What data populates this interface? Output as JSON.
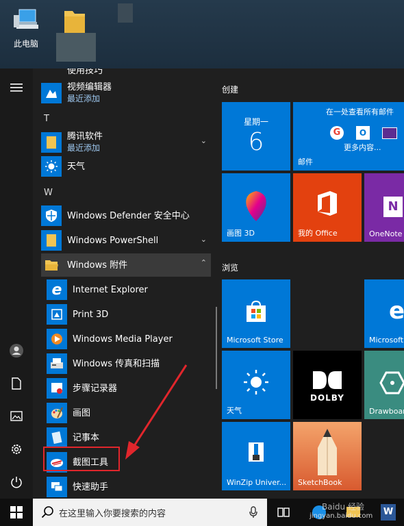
{
  "desktop": {
    "this_pc_label": "此电脑"
  },
  "applist": {
    "partial_top": "使用技巧",
    "video_editor": {
      "name": "视频编辑器",
      "sub": "最近添加"
    },
    "letter_t": "T",
    "tencent": {
      "name": "腾讯软件",
      "sub": "最近添加"
    },
    "weather": "天气",
    "letter_w": "W",
    "defender": "Windows Defender 安全中心",
    "powershell": "Windows PowerShell",
    "accessories": "Windows 附件",
    "ie": "Internet Explorer",
    "print3d": "Print 3D",
    "wmp": "Windows Media Player",
    "fax": "Windows 传真和扫描",
    "steps": "步骤记录器",
    "paint": "画图",
    "notepad": "记事本",
    "snipping": "截图工具",
    "quickassist": "快速助手"
  },
  "tiles": {
    "group_create": "创建",
    "calendar_day": "星期一",
    "calendar_date": "6",
    "mail_header": "在一处查看所有邮件",
    "mail_more": "更多内容...",
    "mail_label": "邮件",
    "paint3d": "画图 3D",
    "office": "我的 Office",
    "onenote": "OneNote",
    "group_browse": "浏览",
    "store": "Microsoft Store",
    "edge": "Microsoft",
    "weather": "天气",
    "drawboard": "Drawboar",
    "winzip": "WinZip Univer...",
    "sketchbook": "SketchBook"
  },
  "taskbar": {
    "search_placeholder": "在这里输入你要搜索的内容"
  },
  "watermark": {
    "site": "jingyan.baidu.com",
    "brand": "Baidu 经验"
  },
  "colors": {
    "accent": "#0078d7",
    "office": "#e3410f",
    "onenote": "#7a2aa5",
    "annotation": "#e1262c"
  }
}
